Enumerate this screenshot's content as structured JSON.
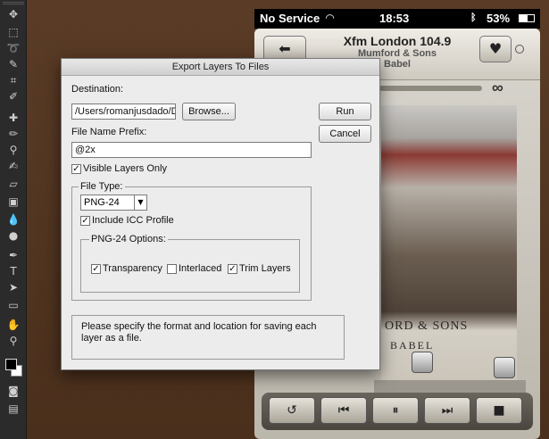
{
  "toolbar": {
    "icons": [
      "move-icon",
      "marquee-icon",
      "lasso-icon",
      "quick-select-icon",
      "crop-icon",
      "eyedropper-icon",
      "healing-brush-icon",
      "brush-icon",
      "clone-stamp-icon",
      "history-brush-icon",
      "eraser-icon",
      "gradient-icon",
      "blur-icon",
      "dodge-icon",
      "pen-icon",
      "type-icon",
      "path-select-icon",
      "shape-icon",
      "hand-icon",
      "zoom-icon"
    ]
  },
  "status_bar": {
    "carrier": "No Service",
    "time": "18:53",
    "battery": "53%"
  },
  "player": {
    "station": "Xfm London 104.9",
    "artist": "Mumford & Sons",
    "album": "Babel",
    "cover_band": "ORD & SONS",
    "cover_album": "BABEL"
  },
  "dialog": {
    "title": "Export Layers To Files",
    "destination_label": "Destination:",
    "destination_value": "/Users/romanjusdado/D",
    "browse_label": "Browse...",
    "run_label": "Run",
    "cancel_label": "Cancel",
    "prefix_label": "File Name Prefix:",
    "prefix_value": "@2x",
    "visible_layers_label": "Visible Layers Only",
    "visible_layers_checked": true,
    "file_type_group": "File Type:",
    "file_type_value": "PNG-24",
    "icc_label": "Include ICC Profile",
    "icc_checked": true,
    "png_options_group": "PNG-24 Options:",
    "transparency_label": "Transparency",
    "transparency_checked": true,
    "interlaced_label": "Interlaced",
    "interlaced_checked": false,
    "trim_label": "Trim Layers",
    "trim_checked": true,
    "hint_text": "Please specify the format and location for saving each layer as a file."
  }
}
